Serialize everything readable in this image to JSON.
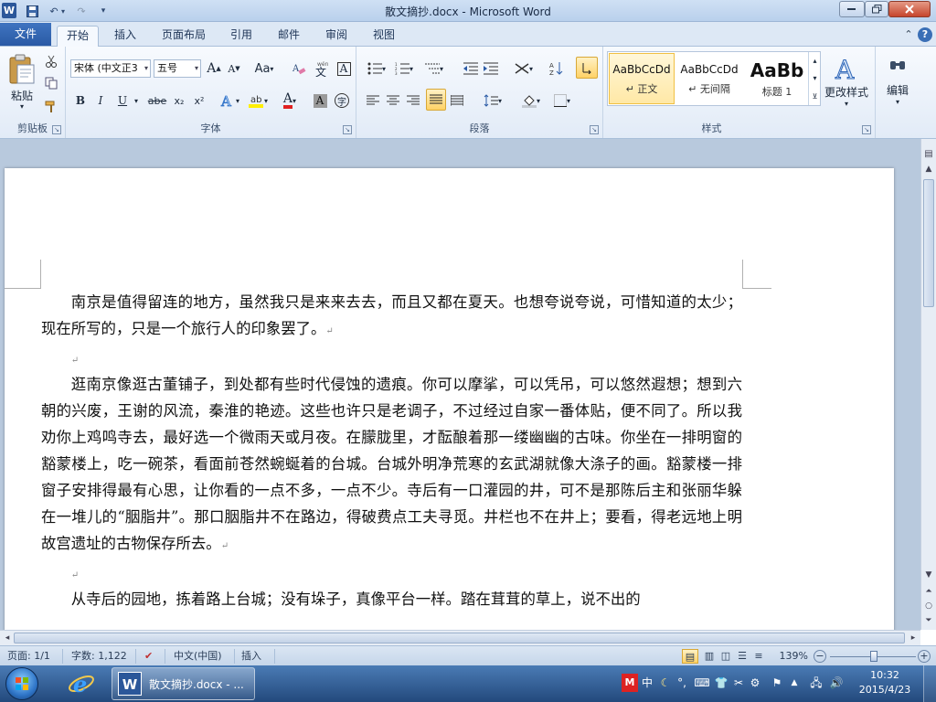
{
  "window": {
    "title": "散文摘抄.docx - Microsoft Word",
    "app_icon_letter": "W"
  },
  "qat": {
    "save_icon": "save-icon",
    "undo_icon": "undo-icon",
    "redo_icon": "redo-icon",
    "customize_icon": "dropdown-icon"
  },
  "tabs": {
    "file": "文件",
    "items": [
      "开始",
      "插入",
      "页面布局",
      "引用",
      "邮件",
      "审阅",
      "视图"
    ],
    "active": "开始"
  },
  "ribbon": {
    "clipboard": {
      "label": "剪贴板",
      "paste_label": "粘贴"
    },
    "font": {
      "label": "字体",
      "font_name": "宋体 (中文正3",
      "font_size": "五号",
      "grow": "A",
      "shrink": "A",
      "case": "Aa",
      "bold": "B",
      "italic": "I",
      "underline": "U",
      "strike": "abe",
      "sub": "x₂",
      "sup": "x²",
      "font_color_letter": "A",
      "char_shading_letter": "A",
      "char_border_letter": "A",
      "enclose_char": "字"
    },
    "paragraph": {
      "label": "段落"
    },
    "styles": {
      "label": "样式",
      "items": [
        {
          "sample": "AaBbCcDd",
          "name": "↵ 正文"
        },
        {
          "sample": "AaBbCcDd",
          "name": "↵ 无间隔"
        },
        {
          "sample": "AaBb",
          "name": "标题 1"
        }
      ],
      "change_styles": "更改样式"
    },
    "editing": {
      "label": "编辑"
    }
  },
  "document": {
    "paragraphs": [
      "南京是值得留连的地方，虽然我只是来来去去，而且又都在夏天。也想夸说夸说，可惜知道的太少；现在所写的，只是一个旅行人的印象罢了。",
      "",
      "逛南京像逛古董铺子，到处都有些时代侵蚀的遗痕。你可以摩挲，可以凭吊，可以悠然遐想；想到六朝的兴废，王谢的风流，秦淮的艳迹。这些也许只是老调子，不过经过自家一番体贴，便不同了。所以我劝你上鸡鸣寺去，最好选一个微雨天或月夜。在朦胧里，才酝酿着那一缕幽幽的古味。你坐在一排明窗的豁蒙楼上，吃一碗茶，看面前苍然蜿蜒着的台城。台城外明净荒寒的玄武湖就像大涤子的画。豁蒙楼一排窗子安排得最有心思，让你看的一点不多，一点不少。寺后有一口灌园的井，可不是那陈后主和张丽华躲在一堆儿的“胭脂井”。那口胭脂井不在路边，得破费点工夫寻觅。井栏也不在井上；要看，得老远地上明故宫遗址的古物保存所去。",
      "",
      "从寺后的园地，拣着路上台城；没有垛子，真像平台一样。踏在茸茸的草上，说不出的"
    ],
    "para_mark": "↵"
  },
  "statusbar": {
    "page": "页面: 1/1",
    "words": "字数: 1,122",
    "language": "中文(中国)",
    "mode": "插入",
    "zoom": "139%",
    "zoom_minus": "−",
    "zoom_plus": "+"
  },
  "taskbar": {
    "word_button": "散文摘抄.docx - ...",
    "ime_lang": "中",
    "time": "10:32",
    "date": "2015/4/23"
  },
  "colors": {
    "accent": "#2b579a",
    "file_tab": "#2a5aa5",
    "selected_style": "#ffe8a6",
    "taskbar": "#23497c"
  }
}
